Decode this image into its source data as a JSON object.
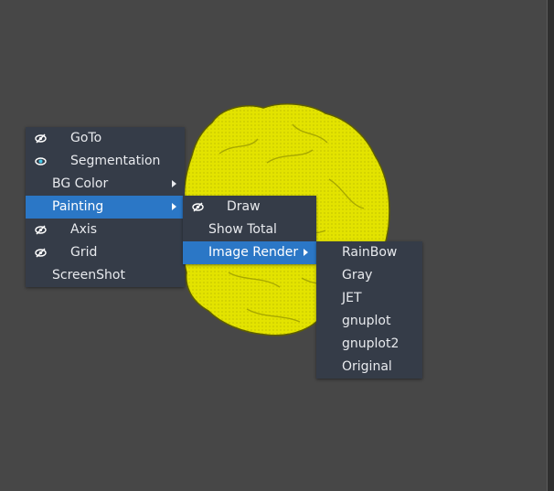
{
  "colors": {
    "background": "#474747",
    "menu_background": "#353c48",
    "menu_active": "#2b77c6",
    "menu_text": "#e8eaee",
    "model": "#e6e600"
  },
  "model": {
    "icon": "yellow-brain-surface-render"
  },
  "main_menu": {
    "items": [
      {
        "label": "GoTo",
        "icon": "eye-slashed-icon"
      },
      {
        "label": "Segmentation",
        "icon": "eye-icon"
      },
      {
        "label": "BG Color",
        "submenu": true
      },
      {
        "label": "Painting",
        "submenu": true,
        "active": true
      },
      {
        "label": "Axis",
        "icon": "eye-slashed-icon"
      },
      {
        "label": "Grid",
        "icon": "eye-slashed-icon"
      },
      {
        "label": "ScreenShot"
      }
    ]
  },
  "painting_menu": {
    "items": [
      {
        "label": "Draw",
        "icon": "eye-slashed-icon"
      },
      {
        "label": "Show Total"
      },
      {
        "label": "Image Render",
        "submenu": true,
        "active": true
      }
    ]
  },
  "render_menu": {
    "items": [
      {
        "label": "RainBow"
      },
      {
        "label": "Gray"
      },
      {
        "label": "JET"
      },
      {
        "label": "gnuplot"
      },
      {
        "label": "gnuplot2"
      },
      {
        "label": "Original"
      }
    ]
  }
}
